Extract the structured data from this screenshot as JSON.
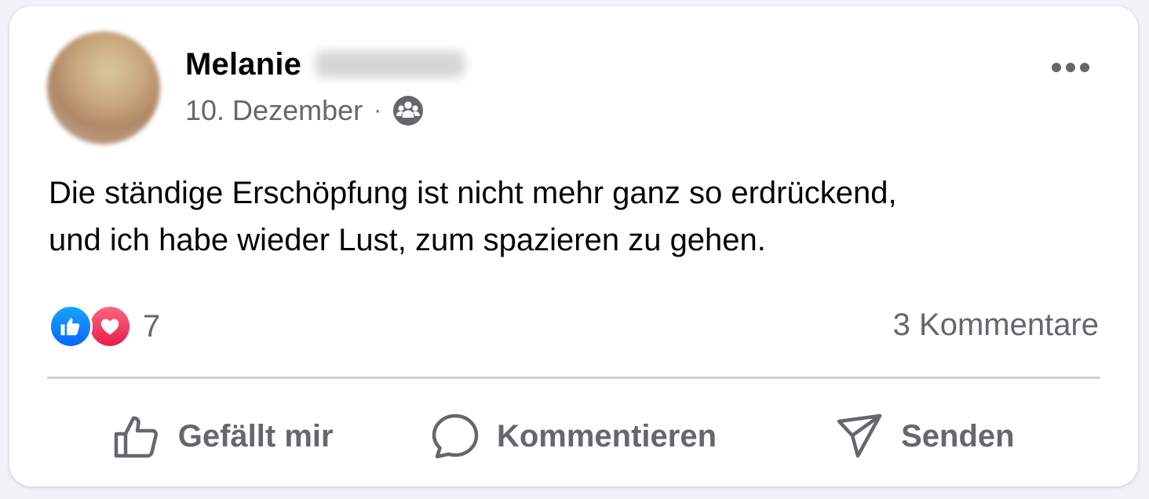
{
  "post": {
    "author_first_name": "Melanie",
    "date": "10. Dezember",
    "separator": "·",
    "audience_icon": "friends-icon",
    "text_line1": "Die ständige Erschöpfung ist nicht mehr ganz so erdrückend,",
    "text_line2": "und ich habe wieder Lust, zum spazieren zu gehen.",
    "reaction_types": [
      "like-icon",
      "love-icon"
    ],
    "reaction_count": "7",
    "comments_label": "3 Kommentare"
  },
  "actions": {
    "like_label": "Gefällt mir",
    "comment_label": "Kommentieren",
    "share_label": "Senden"
  },
  "colors": {
    "text_primary": "#050505",
    "text_secondary": "#65676b",
    "like_blue": "#0866ff",
    "love_red": "#e61e4d",
    "divider": "#ced0d4"
  }
}
